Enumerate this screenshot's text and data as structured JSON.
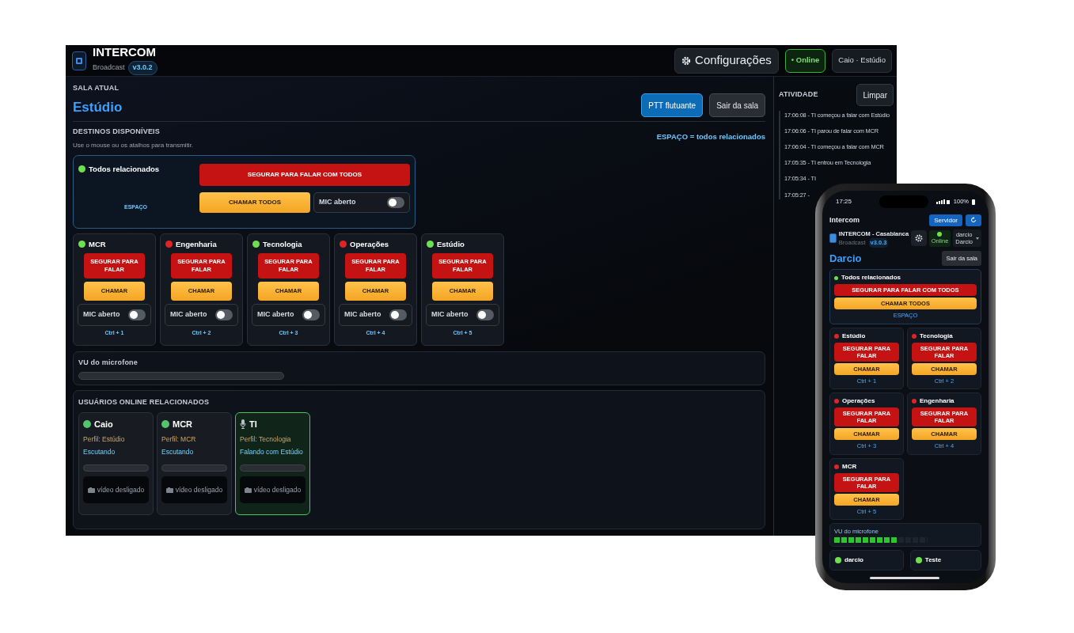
{
  "desktop": {
    "header": {
      "title": "INTERCOM",
      "subtitle": "Broadcast",
      "version": "v3.0.2",
      "settings_button": "Configurações",
      "status": "• Online",
      "user": "Caio · Estúdio"
    },
    "room": {
      "label": "SALA ATUAL",
      "name": "Estúdio",
      "buttons": [
        {
          "label": "PTT flutuante",
          "kind": "primary"
        },
        {
          "label": "Sair da sala",
          "kind": "secondary"
        }
      ]
    },
    "destinations": {
      "title": "DESTINOS DISPONÍVEIS",
      "hint": "Use o mouse ou os atalhos para transmitir.",
      "shortcut_hint": "ESPAÇO = todos relacionados",
      "all": {
        "name": "Todos relacionados",
        "online": true,
        "talk": "SEGURAR PARA FALAR COM TODOS",
        "call": "CHAMAR TODOS",
        "mic_label": "MIC aberto",
        "mic_on": false,
        "shortcut": "ESPAÇO"
      },
      "items": [
        {
          "name": "MCR",
          "online": true,
          "talk": "SEGURAR PARA FALAR",
          "call": "CHAMAR",
          "mic_label": "MIC aberto",
          "mic_on": false,
          "shortcut": "Ctrl + 1"
        },
        {
          "name": "Engenharia",
          "online": false,
          "talk": "SEGURAR PARA FALAR",
          "call": "CHAMAR",
          "mic_label": "MIC aberto",
          "mic_on": false,
          "shortcut": "Ctrl + 2"
        },
        {
          "name": "Tecnologia",
          "online": true,
          "talk": "SEGURAR PARA FALAR",
          "call": "CHAMAR",
          "mic_label": "MIC aberto",
          "mic_on": false,
          "shortcut": "Ctrl + 3"
        },
        {
          "name": "Operações",
          "online": false,
          "talk": "SEGURAR PARA FALAR",
          "call": "CHAMAR",
          "mic_label": "MIC aberto",
          "mic_on": false,
          "shortcut": "Ctrl + 4"
        },
        {
          "name": "Estúdio",
          "online": true,
          "talk": "SEGURAR PARA FALAR",
          "call": "CHAMAR",
          "mic_label": "MIC aberto",
          "mic_on": false,
          "shortcut": "Ctrl + 5"
        }
      ]
    },
    "vu": {
      "label": "VU do microfone"
    },
    "users": {
      "title": "USUÁRIOS ONLINE RELACIONADOS",
      "items": [
        {
          "name": "Caio",
          "kind": "listening",
          "profile": "Perfil: Estúdio",
          "activity": "Escutando",
          "video": "vídeo desligado"
        },
        {
          "name": "MCR",
          "kind": "listening",
          "profile": "Perfil: MCR",
          "activity": "Escutando",
          "video": "vídeo desligado"
        },
        {
          "name": "TI",
          "kind": "talking",
          "profile": "Perfil: Tecnologia",
          "activity": "Falando com Estúdio",
          "video": "vídeo desligado"
        }
      ]
    },
    "activity": {
      "title": "ATIVIDADE",
      "clear_button": "Limpar",
      "entries": [
        "17:06:08 - TI começou a falar com Estúdio",
        "17:06:06 - TI parou de falar com MCR",
        "17:06:04 - TI começou a falar com MCR",
        "17:05:35 - TI entrou em Tecnologia",
        "17:05:34 - TI",
        "17:05:27 -"
      ]
    }
  },
  "phone": {
    "status_bar": {
      "time": "17:25",
      "battery": "100%"
    },
    "app_bar": {
      "title": "Intercom",
      "server_button": "Servidor"
    },
    "header": {
      "title": "INTERCOM - Casablanca",
      "subtitle": "Broadcast",
      "version": "v3.0.3",
      "status": "Online",
      "user_name": "darcio",
      "user_display": "Darcio"
    },
    "room": {
      "name": "Darcio",
      "leave_button": "Sair da sala"
    },
    "all": {
      "name": "Todos relacionados",
      "online": true,
      "talk": "SEGURAR PARA FALAR COM TODOS",
      "call": "CHAMAR TODOS",
      "shortcut": "ESPAÇO"
    },
    "items": [
      {
        "name": "Estúdio",
        "online": false,
        "talk": "SEGURAR PARA FALAR",
        "call": "CHAMAR",
        "shortcut": "Ctrl + 1"
      },
      {
        "name": "Tecnologia",
        "online": false,
        "talk": "SEGURAR PARA FALAR",
        "call": "CHAMAR",
        "shortcut": "Ctrl + 2"
      },
      {
        "name": "Operações",
        "online": false,
        "talk": "SEGURAR PARA FALAR",
        "call": "CHAMAR",
        "shortcut": "Ctrl + 3"
      },
      {
        "name": "Engenharia",
        "online": false,
        "talk": "SEGURAR PARA FALAR",
        "call": "CHAMAR",
        "shortcut": "Ctrl + 4"
      },
      {
        "name": "MCR",
        "online": false,
        "talk": "SEGURAR PARA FALAR",
        "call": "CHAMAR",
        "shortcut": "Ctrl + 5"
      }
    ],
    "vu": {
      "label": "VU do microfone",
      "level": 0.69
    },
    "users": [
      {
        "name": "darcio",
        "online": true
      },
      {
        "name": "Teste",
        "online": true
      }
    ]
  }
}
